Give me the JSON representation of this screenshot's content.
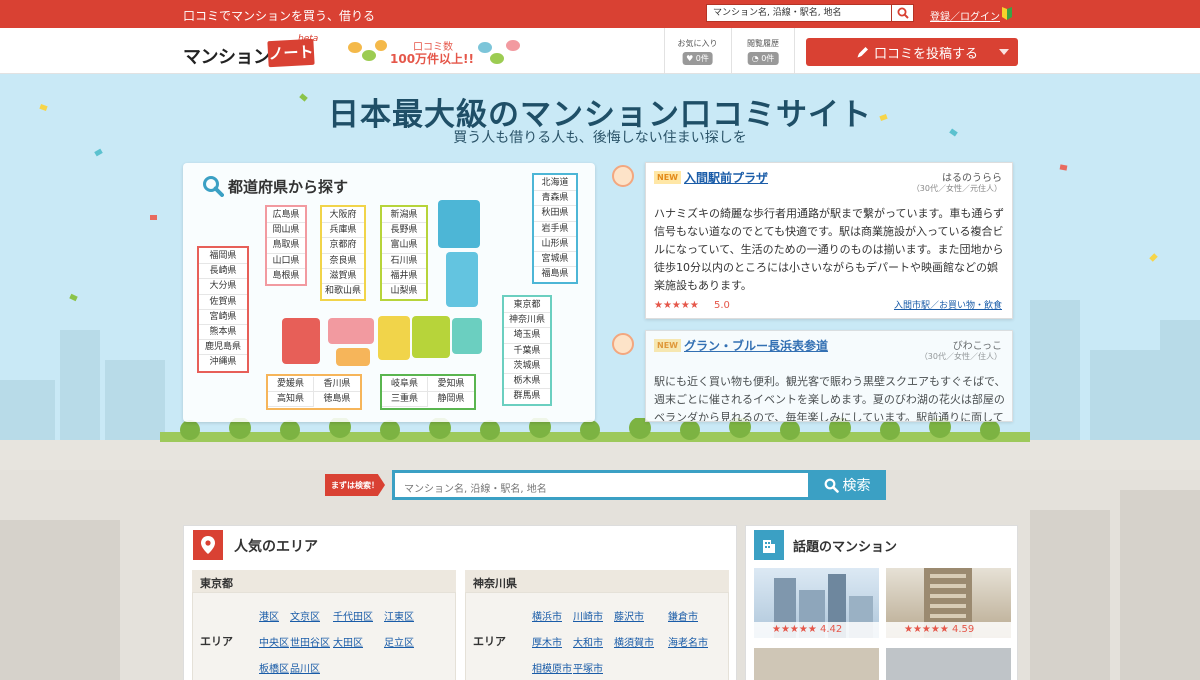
{
  "topbar": {
    "tagline": "口コミでマンションを買う、借りる",
    "search_placeholder": "マンション名, 沿線・駅名, 地名",
    "login_label": "登録／ログイン"
  },
  "header": {
    "logo_text": "マンション",
    "logo_note": "ノート",
    "logo_beta": "beta",
    "review_count_label": "口コミ数",
    "review_count_value": "100万件以上!!",
    "favorites_label": "お気に入り",
    "favorites_count": "♥ 0件",
    "history_label": "閲覧履歴",
    "history_count": "◔ 0件",
    "post_button_label": "口コミを投稿する"
  },
  "hero": {
    "title": "日本最大級のマンション口コミサイト",
    "subtitle": "買う人も借りる人も、後悔しない住まい探しを"
  },
  "prefecture_map": {
    "title": "都道府県から探す",
    "groups": {
      "hokkaido_tohoku": [
        "北海道",
        "青森県",
        "秋田県",
        "岩手県",
        "山形県",
        "宮城県",
        "福島県"
      ],
      "kanto": [
        "東京都",
        "神奈川県",
        "埼玉県",
        "千葉県",
        "茨城県",
        "栃木県",
        "群馬県"
      ],
      "chugoku": [
        "広島県",
        "岡山県",
        "鳥取県",
        "山口県",
        "島根県"
      ],
      "kinki": [
        "大阪府",
        "兵庫県",
        "京都府",
        "奈良県",
        "滋賀県",
        "和歌山県"
      ],
      "chubu": [
        "新潟県",
        "長野県",
        "富山県",
        "石川県",
        "福井県",
        "山梨県"
      ],
      "kyushu": [
        "福岡県",
        "長崎県",
        "大分県",
        "佐賀県",
        "宮崎県",
        "熊本県",
        "鹿児島県",
        "沖縄県"
      ],
      "shikoku": [
        "愛媛県",
        "香川県",
        "高知県",
        "徳島県"
      ],
      "tokai": [
        "岐阜県",
        "愛知県",
        "三重県",
        "静岡県"
      ]
    }
  },
  "reviews": [
    {
      "badge": "NEW",
      "title": "入間駅前プラザ",
      "reviewer": "はるのうらら",
      "reviewer_info": "（30代／女性／元住人）",
      "text": "ハナミズキの綺麗な歩行者用通路が駅まで繋がっています。車も通らず信号もない道なのでとても快適です。駅は商業施設が入っている複合ビルになっていて、生活のための一通りのものは揃います。また団地から徒歩10分以内のところには小さいながらもデパートや映画館などの娯楽施設もあります。",
      "stars": "★★★★★",
      "rating": "5.0",
      "tag": "入間市駅／お買い物・飲食"
    },
    {
      "badge": "NEW",
      "title": "グラン・ブルー長浜表参道",
      "reviewer": "びわこっこ",
      "reviewer_info": "（30代／女性／住人）",
      "text": "駅にも近く買い物も便利。観光客で賑わう黒壁スクエアもすぐそばで、週末ごとに催されるイベントを楽しめます。夏のびわ湖の花火は部屋のベランダから見れるので、毎年楽しみにしています。駅前通りに面しているので、コ"
    }
  ],
  "main_search": {
    "badge_label": "まずは検索！",
    "placeholder": "マンション名, 沿線・駅名, 地名",
    "button_label": "検索"
  },
  "popular_areas": {
    "title": "人気のエリア",
    "area_label": "エリア",
    "regions": [
      {
        "name": "東京都",
        "cities": [
          "港区",
          "文京区",
          "千代田区",
          "江東区",
          "中央区",
          "世田谷区",
          "大田区",
          "足立区",
          "板橋区",
          "品川区"
        ]
      },
      {
        "name": "神奈川県",
        "cities": [
          "横浜市",
          "川崎市",
          "藤沢市",
          "鎌倉市",
          "厚木市",
          "大和市",
          "横須賀市",
          "海老名市",
          "相模原市",
          "平塚市"
        ]
      }
    ]
  },
  "trending": {
    "title": "話題のマンション",
    "items": [
      {
        "stars": "★★★★★",
        "rating": "4.42"
      },
      {
        "stars": "★★★★★",
        "rating": "4.59"
      }
    ]
  },
  "colors": {
    "brand_red": "#d94133",
    "accent_blue": "#3ba0c4",
    "link": "#1a5ca8",
    "sky": "#c9e9f6"
  }
}
